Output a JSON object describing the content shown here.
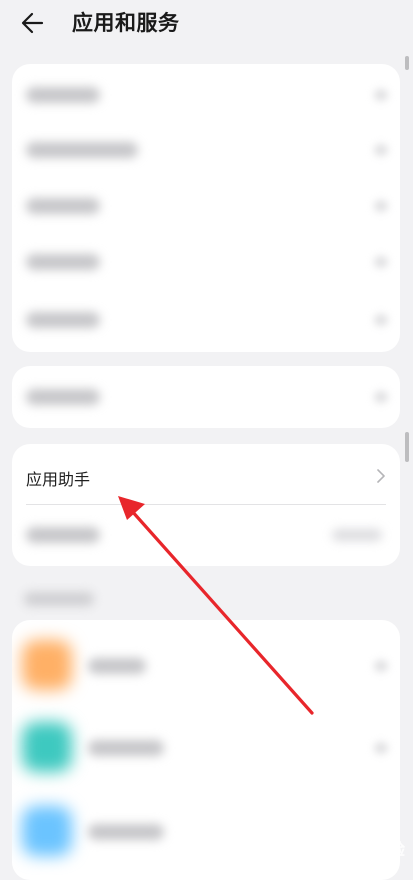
{
  "header": {
    "title": "应用和服务",
    "back_icon": "arrow-left-icon"
  },
  "assistant_card": {
    "label": "应用助手",
    "chevron_icon": "chevron-right-icon"
  },
  "annotation": {
    "color": "#e8262b"
  },
  "watermark": {
    "text": "Baidu 经验"
  },
  "blurred_app_icon_colors": [
    "#ffb066",
    "#3ec9c0",
    "#6bc4ff"
  ]
}
